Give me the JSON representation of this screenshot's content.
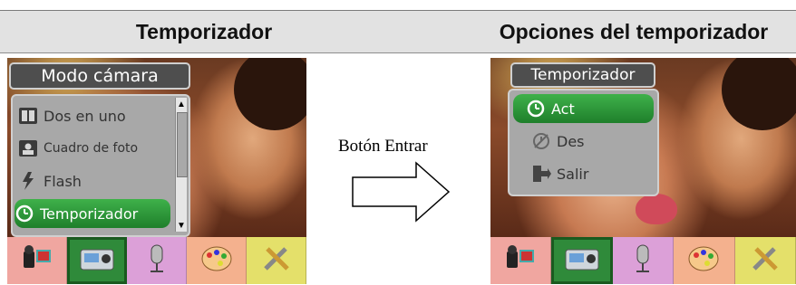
{
  "header": {
    "left_title": "Temporizador",
    "right_title": "Opciones del temporizador"
  },
  "left_screen": {
    "menu_title": "Modo cámara",
    "items": [
      {
        "label": "Dos en uno",
        "icon": "two-in-one-icon"
      },
      {
        "label": "Cuadro de foto",
        "icon": "photo-frame-icon"
      },
      {
        "label": "Flash",
        "icon": "flash-icon"
      },
      {
        "label": "Temporizador",
        "icon": "timer-icon",
        "selected": true
      }
    ]
  },
  "middle": {
    "button_label": "Botón Entrar"
  },
  "right_screen": {
    "menu_title": "Temporizador",
    "items": [
      {
        "label": "Act",
        "icon": "timer-on-icon",
        "selected": true
      },
      {
        "label": "Des",
        "icon": "timer-off-icon"
      },
      {
        "label": "Salir",
        "icon": "exit-icon"
      }
    ]
  },
  "bottom_bar_icons": [
    "video-camera-icon",
    "camera-icon",
    "microphone-icon",
    "palette-icon",
    "tools-icon"
  ],
  "colors": {
    "selected_green": "#2f8a3a",
    "menu_gray": "#a8a8a8",
    "title_gray": "#4e4e4e"
  }
}
